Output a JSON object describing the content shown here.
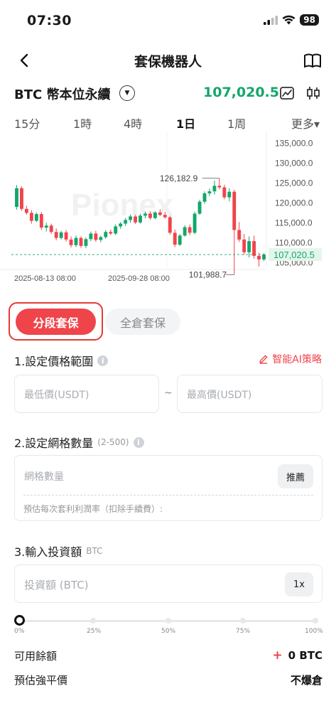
{
  "status": {
    "time": "07:30",
    "battery": "98"
  },
  "nav": {
    "title": "套保機器人"
  },
  "pair": {
    "name": "BTC 幣本位永續",
    "price": "107,020.5"
  },
  "timeframes": [
    {
      "label": "15分",
      "active": false
    },
    {
      "label": "1時",
      "active": false
    },
    {
      "label": "4時",
      "active": false
    },
    {
      "label": "1日",
      "active": true
    },
    {
      "label": "1周",
      "active": false
    },
    {
      "label": "更多▾",
      "active": false
    }
  ],
  "chart_data": {
    "type": "candlestick",
    "y_ticks": [
      "135,000.0",
      "130,000.0",
      "125,000.0",
      "120,000.0",
      "115,000.0",
      "110,000.0",
      "105,000.0"
    ],
    "ylim": [
      104000,
      136500
    ],
    "x_tick_labels": [
      "2025-08-13 08:00",
      "2025-09-28 08:00"
    ],
    "high_label": "126,182.9",
    "low_label": "101,988.7",
    "last_price_label": "107,020.5",
    "last_price": 107020.5,
    "watermark": "Pionex",
    "colors": {
      "up": "#14a66b",
      "down": "#f0444b"
    },
    "candles": [
      [
        119000,
        124500,
        118300,
        123700
      ],
      [
        123700,
        124200,
        118000,
        118500
      ],
      [
        118500,
        119300,
        117000,
        117500
      ],
      [
        117500,
        118200,
        114800,
        115500
      ],
      [
        115500,
        117600,
        115200,
        117200
      ],
      [
        117200,
        117700,
        113200,
        113800
      ],
      [
        113800,
        115000,
        112800,
        114300
      ],
      [
        114300,
        114800,
        112200,
        112700
      ],
      [
        112700,
        113600,
        110600,
        111200
      ],
      [
        111200,
        113000,
        110800,
        112600
      ],
      [
        112600,
        113200,
        110300,
        110800
      ],
      [
        110800,
        111600,
        108800,
        109400
      ],
      [
        109400,
        111800,
        108900,
        111200
      ],
      [
        111200,
        111600,
        108700,
        109200
      ],
      [
        109200,
        111300,
        108600,
        110900
      ],
      [
        110900,
        112800,
        110400,
        112300
      ],
      [
        112300,
        113000,
        110200,
        110700
      ],
      [
        110700,
        111800,
        110100,
        111400
      ],
      [
        111400,
        113200,
        111000,
        112700
      ],
      [
        112700,
        113300,
        111900,
        112300
      ],
      [
        112300,
        114600,
        111900,
        114100
      ],
      [
        114100,
        115200,
        113500,
        114800
      ],
      [
        114800,
        116200,
        114200,
        115700
      ],
      [
        115700,
        117100,
        115000,
        116600
      ],
      [
        116600,
        117000,
        114700,
        115100
      ],
      [
        115100,
        117300,
        114800,
        116800
      ],
      [
        116800,
        117800,
        116100,
        117300
      ],
      [
        117300,
        117900,
        115800,
        116200
      ],
      [
        116200,
        117900,
        115900,
        117600
      ],
      [
        117600,
        118400,
        116700,
        117000
      ],
      [
        117000,
        117800,
        116000,
        116400
      ],
      [
        116400,
        116800,
        112000,
        112500
      ],
      [
        112500,
        113300,
        108900,
        109500
      ],
      [
        109500,
        112200,
        109200,
        111800
      ],
      [
        111800,
        114400,
        111500,
        113900
      ],
      [
        113900,
        114600,
        111900,
        112500
      ],
      [
        112500,
        117800,
        112100,
        117300
      ],
      [
        117300,
        120800,
        117000,
        120300
      ],
      [
        120300,
        122900,
        119800,
        122400
      ],
      [
        122400,
        123600,
        121700,
        122900
      ],
      [
        122900,
        125600,
        122100,
        124300
      ],
      [
        124300,
        126182.9,
        123400,
        123900
      ],
      [
        123900,
        124600,
        120900,
        121400
      ],
      [
        121400,
        123700,
        120400,
        122800
      ],
      [
        122800,
        123300,
        101988.7,
        113200
      ],
      [
        113200,
        115200,
        110200,
        110800
      ],
      [
        110800,
        112200,
        107000,
        107600
      ],
      [
        107600,
        111600,
        106300,
        110400
      ],
      [
        110400,
        111800,
        106000,
        106700
      ],
      [
        106700,
        107500,
        104000,
        105800
      ],
      [
        105800,
        107400,
        105400,
        107020.5
      ]
    ]
  },
  "modes": {
    "active": "分段套保",
    "other": "全倉套保"
  },
  "section1": {
    "title": "1.設定價格範圍",
    "ai_link": "智能AI策略",
    "min_placeholder": "最低價(USDT)",
    "max_placeholder": "最高價(USDT)",
    "separator": "~"
  },
  "section2": {
    "title": "2.設定網格數量",
    "hint": "(2-500)",
    "placeholder": "網格數量",
    "recommend": "推薦",
    "note": "預估每次套利利潤率（扣除手續費）:"
  },
  "section3": {
    "title": "3.輸入投資額",
    "unit": "BTC",
    "placeholder": "投資額 (BTC)",
    "leverage": "1x"
  },
  "slider": {
    "labels": [
      "0%",
      "25%",
      "50%",
      "75%",
      "100%"
    ],
    "value_percent": 0
  },
  "available": {
    "label": "可用餘額",
    "value": "0 BTC"
  },
  "liquidation": {
    "label": "預估強平價",
    "value": "不爆倉"
  }
}
